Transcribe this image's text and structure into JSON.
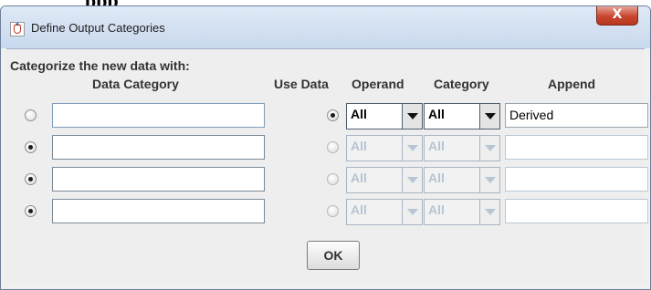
{
  "page_header": {
    "text": "ppp"
  },
  "window": {
    "title": "Define Output Categories",
    "close_label": "X"
  },
  "dialog": {
    "heading": "Categorize the new data with:",
    "columns": {
      "data_category": "Data Category",
      "use_data": "Use Data",
      "operand": "Operand",
      "category": "Category",
      "append": "Append"
    },
    "rows": [
      {
        "category_radio_selected": false,
        "category_value": "",
        "use_data_selected": true,
        "operand": "All",
        "category": "All",
        "append": "Derived",
        "enabled": true
      },
      {
        "category_radio_selected": true,
        "category_value": "",
        "use_data_selected": false,
        "operand": "All",
        "category": "All",
        "append": "",
        "enabled": false
      },
      {
        "category_radio_selected": true,
        "category_value": "",
        "use_data_selected": false,
        "operand": "All",
        "category": "All",
        "append": "",
        "enabled": false
      },
      {
        "category_radio_selected": true,
        "category_value": "",
        "use_data_selected": false,
        "operand": "All",
        "category": "All",
        "append": "",
        "enabled": false
      }
    ],
    "ok_label": "OK"
  },
  "colors": {
    "title_bar": "#c9d9ee",
    "close_button": "#c8462f",
    "dialog_bg": "#eeeeee"
  }
}
